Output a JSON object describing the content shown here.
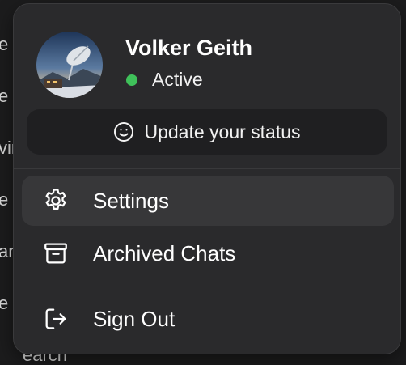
{
  "background": {
    "fragments": [
      "e",
      "e",
      "vir",
      "e",
      "ar",
      "e",
      "earch"
    ]
  },
  "profile": {
    "name": "Volker Geith",
    "presence": "Active",
    "presence_color": "#3fc15a",
    "avatar_icon": "avatar-photo"
  },
  "status_button": {
    "label": "Update your status",
    "icon": "smiley-icon"
  },
  "menu": {
    "items": [
      {
        "label": "Settings",
        "icon": "gear-icon",
        "active": true
      },
      {
        "label": "Archived Chats",
        "icon": "archive-box-icon",
        "active": false
      },
      {
        "label": "Sign Out",
        "icon": "sign-out-icon",
        "active": false
      }
    ]
  },
  "colors": {
    "panel_bg": "#2a2a2c",
    "hover_bg": "#373739",
    "status_button_bg": "#1f1f21",
    "text": "#ffffff"
  }
}
